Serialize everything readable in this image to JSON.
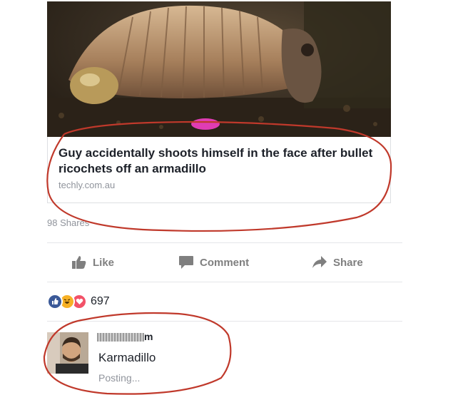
{
  "post": {
    "link_title": "Guy accidentally shoots himself in the face after bullet ricochets off an armadillo",
    "link_domain": "techly.com.au",
    "shares": "98 Shares"
  },
  "actions": {
    "like": "Like",
    "comment": "Comment",
    "share": "Share"
  },
  "reactions": {
    "count": "697",
    "icons": [
      "like-icon",
      "haha-icon",
      "love-icon"
    ]
  },
  "comment": {
    "author_suffix": "m",
    "text": "Karmadillo",
    "status": "Posting..."
  },
  "colors": {
    "annotation": "#c0392b",
    "like_blue": "#3b5998",
    "love_red": "#f25268",
    "haha_yellow": "#f7b125",
    "muted": "#90949c"
  }
}
